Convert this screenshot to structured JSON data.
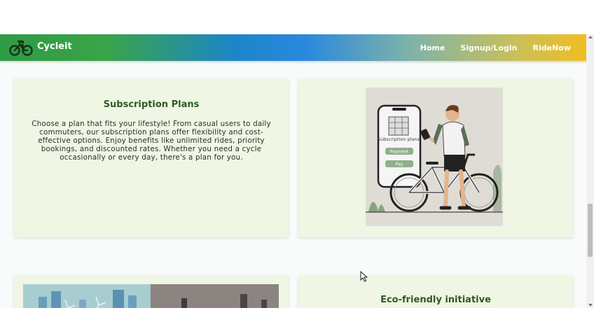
{
  "navbar": {
    "brand": "Cycleit",
    "logo_icon": "bicycle-icon",
    "links": [
      "Home",
      "Signup/Login",
      "RideNow"
    ]
  },
  "subscription": {
    "title": "Subscription Plans",
    "text": "Choose a plan that fits your lifestyle! From casual users to daily commuters, our subscription plans offer flexibility and cost-effective options. Enjoy benefits like unlimited rides, priority bookings, and discounted rates. Whether you need a cycle occasionally or every day, there's a plan for you."
  },
  "illustration": {
    "phone_title": "Subscription plans",
    "phone_btn1": "Payment",
    "phone_btn2": "Pay"
  },
  "eco": {
    "title": "Eco-friendly initiative"
  },
  "colors": {
    "card_bg": "#eff6e4",
    "title_green": "#2f5a24",
    "nav_start": "#2e9a44",
    "nav_mid": "#2a88de",
    "nav_end": "#f1bd23"
  }
}
